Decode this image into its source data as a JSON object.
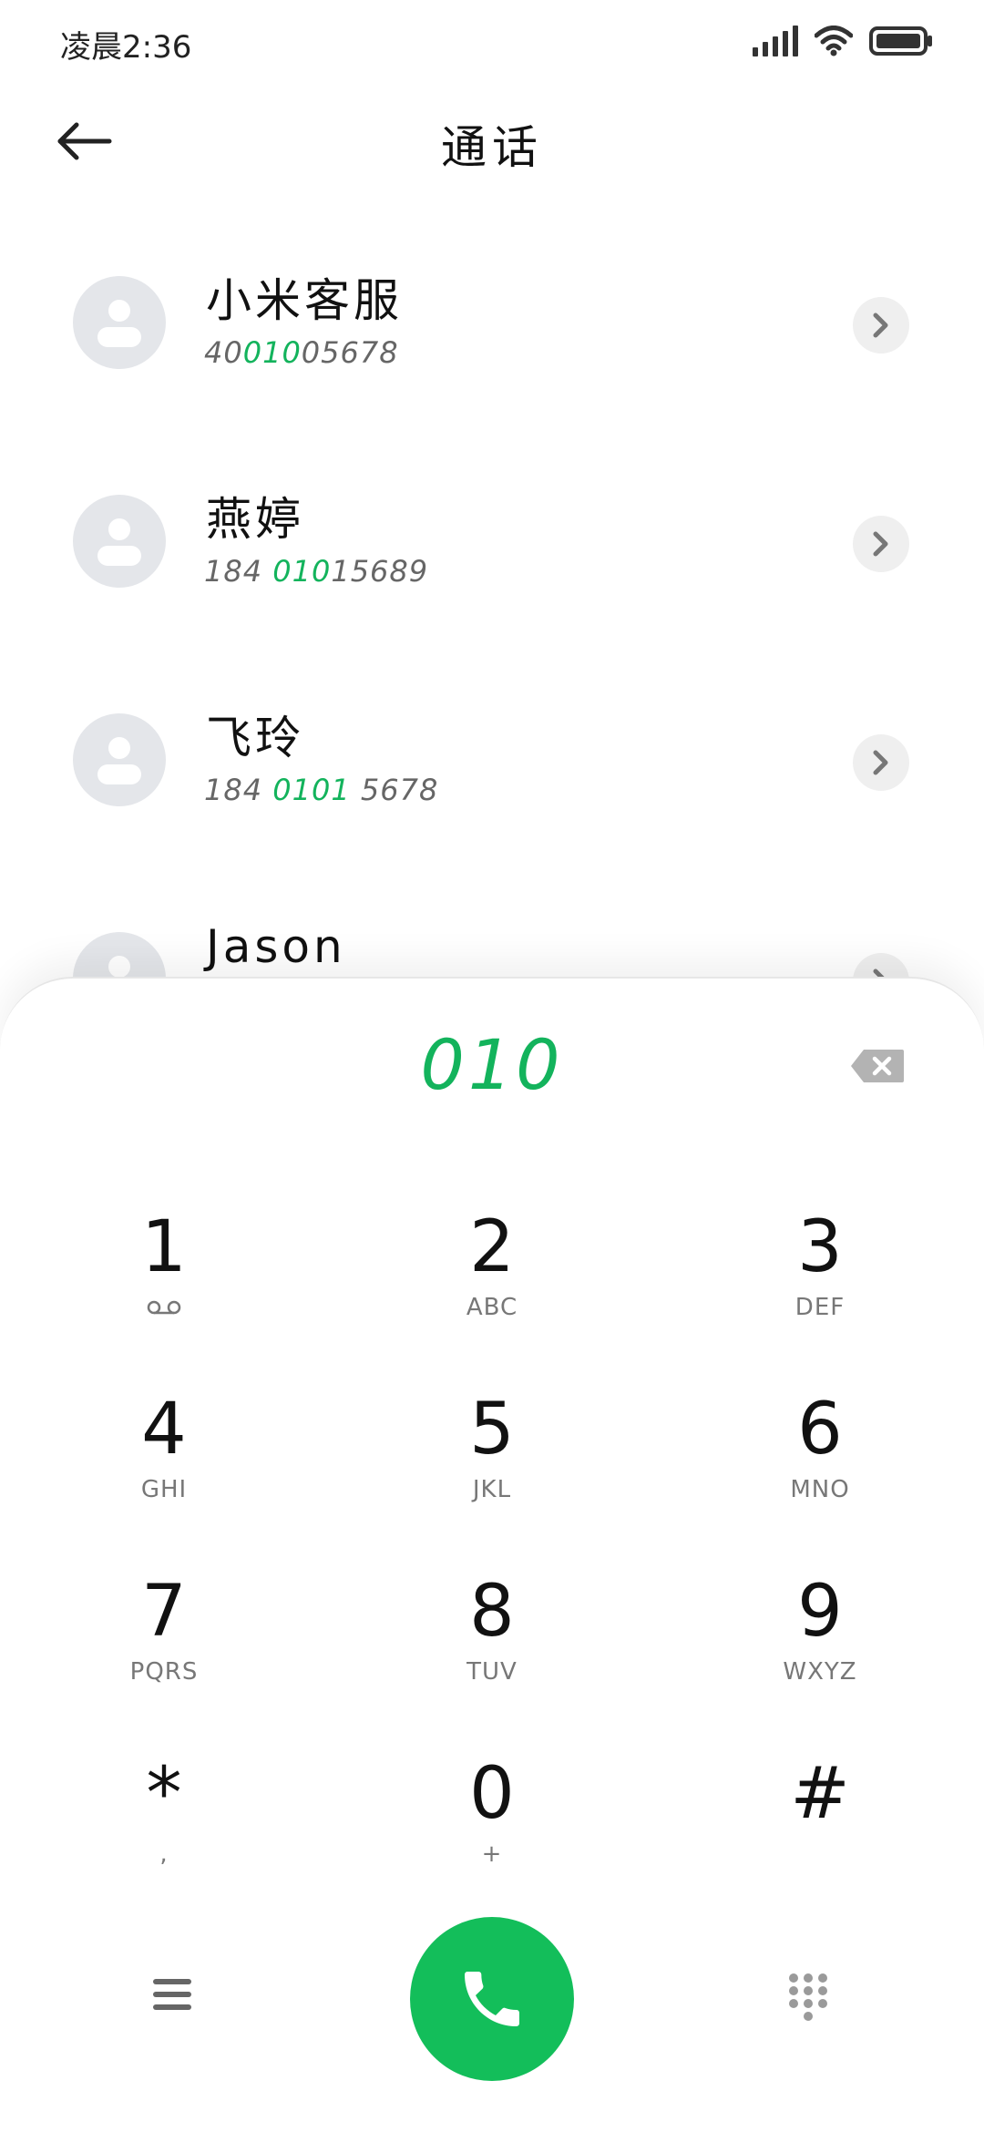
{
  "status_bar": {
    "time": "凌晨2:36"
  },
  "header": {
    "title": "通话"
  },
  "contacts": [
    {
      "name": "小米客服",
      "number_parts": [
        "40",
        "010",
        "05678"
      ]
    },
    {
      "name": "燕婷",
      "number_parts": [
        "184 ",
        "010",
        "15689"
      ]
    },
    {
      "name": "飞玲",
      "number_parts": [
        "184 ",
        "0101",
        " 5678"
      ]
    },
    {
      "name": "Jason",
      "number_parts": [
        "",
        "",
        ""
      ]
    }
  ],
  "dial": {
    "input": "010"
  },
  "keypad": [
    {
      "digit": "1",
      "letters": ""
    },
    {
      "digit": "2",
      "letters": "ABC"
    },
    {
      "digit": "3",
      "letters": "DEF"
    },
    {
      "digit": "4",
      "letters": "GHI"
    },
    {
      "digit": "5",
      "letters": "JKL"
    },
    {
      "digit": "6",
      "letters": "MNO"
    },
    {
      "digit": "7",
      "letters": "PQRS"
    },
    {
      "digit": "8",
      "letters": "TUV"
    },
    {
      "digit": "9",
      "letters": "WXYZ"
    },
    {
      "digit": "*",
      "letters": ","
    },
    {
      "digit": "0",
      "letters": "+"
    },
    {
      "digit": "#",
      "letters": ""
    }
  ],
  "colors": {
    "accent": "#13b35c",
    "call_button": "#13be5a",
    "avatar_bg": "#e4e6ea"
  },
  "icons": {
    "back": "arrow-left-icon",
    "chevron": "chevron-right-icon",
    "backspace": "backspace-icon",
    "voicemail": "voicemail-icon",
    "menu": "menu-icon",
    "call": "phone-icon",
    "dialpad": "dialpad-icon"
  }
}
